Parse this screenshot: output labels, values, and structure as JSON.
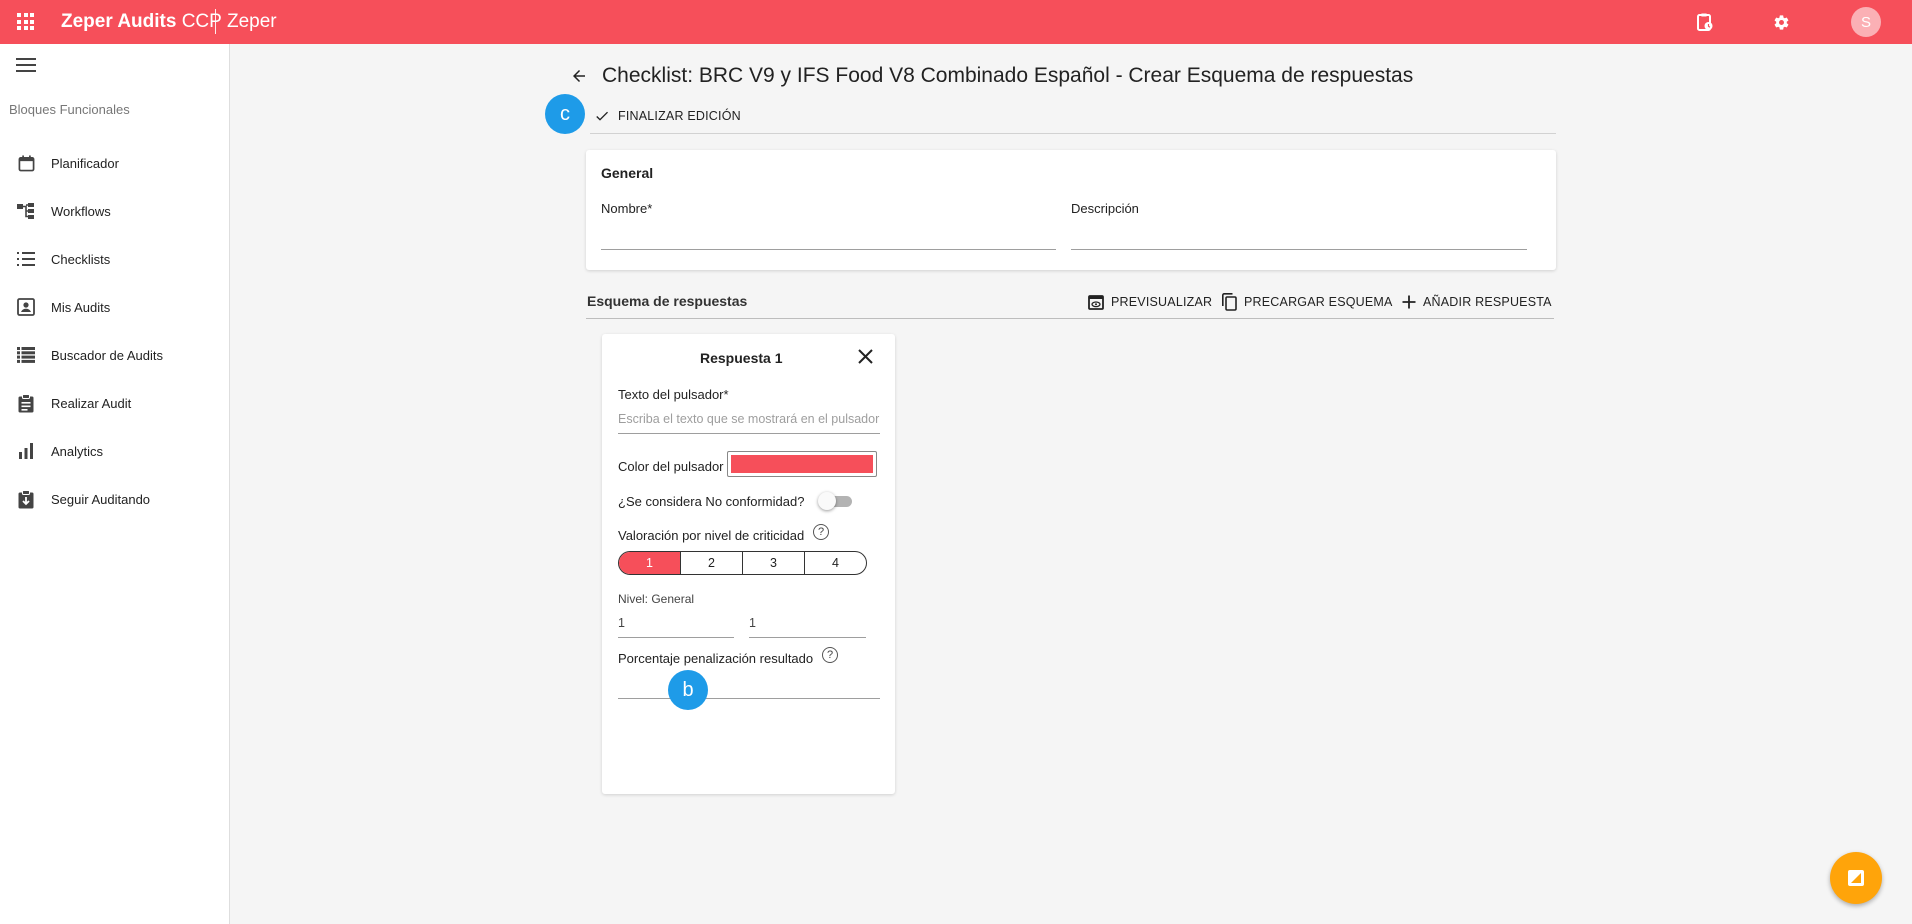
{
  "topbar": {
    "brand_bold": "Zeper Audits",
    "brand_light": " CCP",
    "tenant": "Zeper",
    "avatar_initial": "S",
    "icons": [
      "apps-grid-icon",
      "clipboard-clock-icon",
      "gear-icon"
    ]
  },
  "sidebar": {
    "section_label": "Bloques Funcionales",
    "items": [
      {
        "label": "Planificador",
        "icon": "calendar-icon"
      },
      {
        "label": "Workflows",
        "icon": "workflow-icon"
      },
      {
        "label": "Checklists",
        "icon": "list-icon"
      },
      {
        "label": "Mis Audits",
        "icon": "user-badge-icon"
      },
      {
        "label": "Buscador de Audits",
        "icon": "list-view-icon"
      },
      {
        "label": "Realizar Audit",
        "icon": "clipboard-icon"
      },
      {
        "label": "Analytics",
        "icon": "bar-chart-icon"
      },
      {
        "label": "Seguir Auditando",
        "icon": "clipboard-arrow-icon"
      }
    ]
  },
  "page": {
    "title": "Checklist: BRC V9 y IFS Food V8 Combinado Español - Crear Esquema de respuestas",
    "finish_label": "FINALIZAR EDICIÓN",
    "marker_c": "c",
    "marker_b": "b"
  },
  "general": {
    "title": "General",
    "name_label": "Nombre*",
    "name_value": "",
    "description_label": "Descripción",
    "description_value": ""
  },
  "schema": {
    "title": "Esquema de respuestas",
    "preview_label": "PREVISUALIZAR",
    "preload_label": "PRECARGAR ESQUEMA",
    "add_label": "AÑADIR RESPUESTA"
  },
  "response": {
    "title": "Respuesta 1",
    "button_text_label": "Texto del pulsador*",
    "button_text_placeholder": "Escriba el texto que se mostrará en el pulsador",
    "color_label": "Color del pulsador",
    "color_value": "#f64f5a",
    "nonconformity_label": "¿Se considera No conformidad?",
    "nonconformity_value": false,
    "criticality_label": "Valoración por nivel de criticidad",
    "criticality_options": [
      "1",
      "2",
      "3",
      "4"
    ],
    "criticality_selected": "1",
    "level_label": "Nivel: General",
    "level_value_1": "1",
    "level_value_2": "1",
    "penalty_label": "Porcentaje penalización resultado",
    "penalty_value": ""
  },
  "colors": {
    "brand": "#f64f5a",
    "marker": "#1e9be8",
    "fab": "#ffa40a"
  }
}
